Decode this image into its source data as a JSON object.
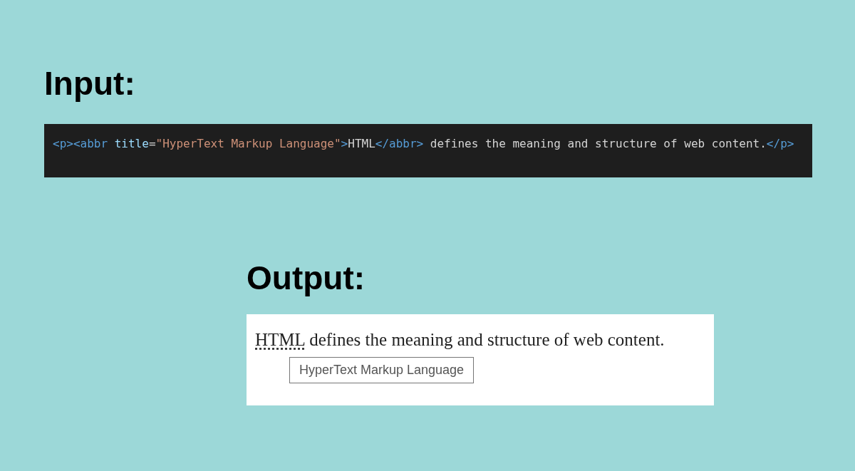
{
  "input_heading": "Input:",
  "code": [
    {
      "kind": "tag",
      "text": "<p><abbr "
    },
    {
      "kind": "attr",
      "text": "title"
    },
    {
      "kind": "plain",
      "text": "="
    },
    {
      "kind": "string",
      "text": "\"HyperText Markup Language\""
    },
    {
      "kind": "tag",
      "text": ">"
    },
    {
      "kind": "plain",
      "text": "HTML"
    },
    {
      "kind": "tag",
      "text": "</abbr>"
    },
    {
      "kind": "plain",
      "text": " defines the meaning and structure of web content."
    },
    {
      "kind": "tag",
      "text": "</p>"
    }
  ],
  "output_heading": "Output:",
  "output": {
    "abbr": "HTML",
    "sentence": " defines the meaning and structure of web content.",
    "tooltip": "HyperText Markup Language"
  }
}
